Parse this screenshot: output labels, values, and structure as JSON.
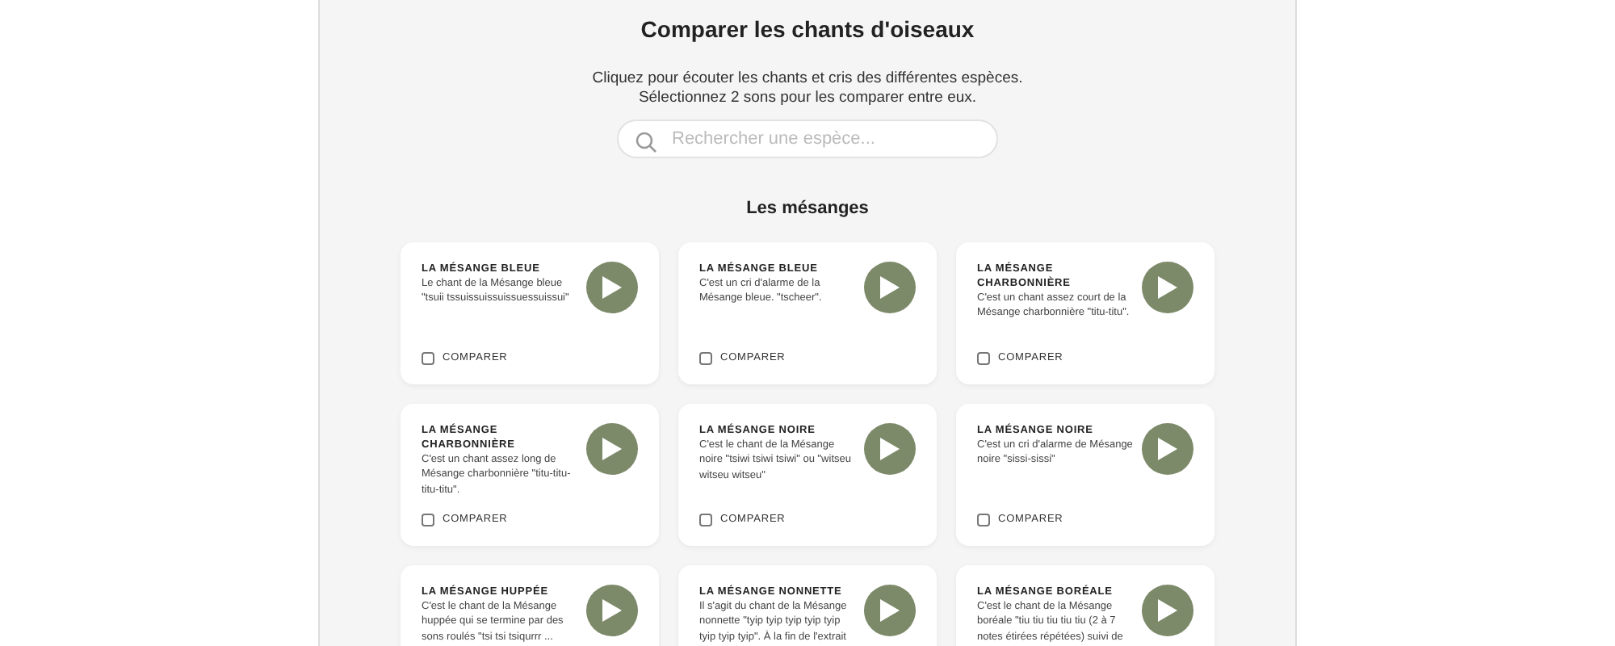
{
  "title": "Comparer les chants d'oiseaux",
  "intro": [
    "Cliquez pour écouter les chants et cris des différentes espèces.",
    "Sélectionnez 2 sons pour les comparer entre eux."
  ],
  "search": {
    "placeholder": "Rechercher une espèce..."
  },
  "section": {
    "title": "Les mésanges",
    "cards": [
      {
        "title": "LA MÉSANGE BLEUE",
        "description": "Le chant de la Mésange bleue \"tsuii tssuissuissuissuessuissui\"",
        "compare": {
          "label": "COMPARER",
          "checked": false
        }
      },
      {
        "title": "LA MÉSANGE BLEUE",
        "description": "C'est un cri d'alarme de la Mésange bleue. \"tscheer\".",
        "compare": {
          "label": "COMPARER",
          "checked": false
        }
      },
      {
        "title": "LA MÉSANGE CHARBONNIÈRE",
        "description": "C'est un chant assez court de la Mésange charbonnière \"titu-titu\".",
        "compare": {
          "label": "COMPARER",
          "checked": false
        }
      },
      {
        "title": "LA MÉSANGE CHARBONNIÈRE",
        "description": "C'est un chant assez long de Mésange charbonnière \"titu-titu-titu-titu\".",
        "compare": {
          "label": "COMPARER",
          "checked": false
        }
      },
      {
        "title": "LA MÉSANGE NOIRE",
        "description": "C'est le chant de la Mésange noire \"tsiwi tsiwi tsiwi\" ou \"witseu witseu witseu\"",
        "compare": {
          "label": "COMPARER",
          "checked": false
        }
      },
      {
        "title": "LA MÉSANGE NOIRE",
        "description": "C'est un cri d'alarme de Mésange noire \"sissi-sissi\"",
        "compare": {
          "label": "COMPARER",
          "checked": false
        }
      },
      {
        "title": "LA MÉSANGE HUPPÉE",
        "description": "C'est le chant de la Mésange huppée qui se termine par des sons roulés \"tsi tsi tsiqurrr ..."
      },
      {
        "title": "LA MÉSANGE NONNETTE",
        "description": "Il s'agit du chant de la Mésange nonnette \"tyip tyip tyip tyip tyip tyip tyip tyip\". À la fin de l'extrait"
      },
      {
        "title": "LA MÉSANGE BORÉALE",
        "description": "C'est le chant de la Mésange boréale \"tiu tiu tiu tiu tiu (2 à 7 notes étirées répétées) suivi de"
      }
    ]
  }
}
